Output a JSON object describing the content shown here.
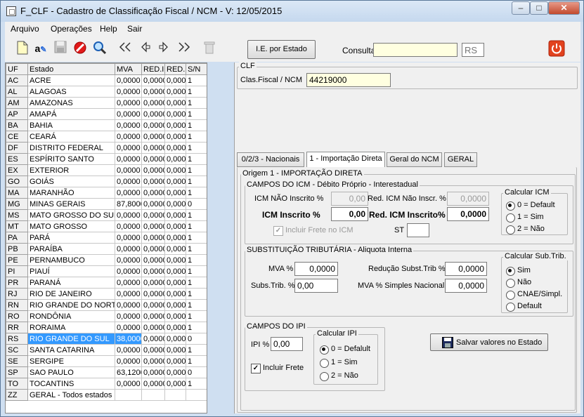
{
  "window": {
    "title": "F_CLF - Cadastro de Classificação Fiscal / NCM - V: 12/05/2015"
  },
  "menu": [
    "Arquivo",
    "Operações",
    "Help",
    "Sair"
  ],
  "toolbar": {
    "ie_button": "I.E. por Estado",
    "consulta_label": "Consulta",
    "consulta_value": "",
    "uf_value": "RS"
  },
  "grid": {
    "headers": [
      "UF",
      "Estado",
      "MVA",
      "RED.ICM",
      "RED.",
      "S/N"
    ],
    "rows": [
      [
        "AC",
        "ACRE",
        "0,0000",
        "0,0000",
        "0,000",
        "1"
      ],
      [
        "AL",
        "ALAGOAS",
        "0,0000",
        "0,0000",
        "0,000",
        "1"
      ],
      [
        "AM",
        "AMAZONAS",
        "0,0000",
        "0,0000",
        "0,000",
        "1"
      ],
      [
        "AP",
        "AMAPÁ",
        "0,0000",
        "0,0000",
        "0,000",
        "1"
      ],
      [
        "BA",
        "BAHIA",
        "0,0000",
        "0,0000",
        "0,000",
        "1"
      ],
      [
        "CE",
        "CEARÁ",
        "0,0000",
        "0,0000",
        "0,000",
        "1"
      ],
      [
        "DF",
        "DISTRITO FEDERAL",
        "0,0000",
        "0,0000",
        "0,000",
        "1"
      ],
      [
        "ES",
        "ESPÍRITO SANTO",
        "0,0000",
        "0,0000",
        "0,000",
        "1"
      ],
      [
        "EX",
        "EXTERIOR",
        "0,0000",
        "0,0000",
        "0,000",
        "1"
      ],
      [
        "GO",
        "GOIÁS",
        "0,0000",
        "0,0000",
        "0,000",
        "1"
      ],
      [
        "MA",
        "MARANHÃO",
        "0,0000",
        "0,0000",
        "0,000",
        "1"
      ],
      [
        "MG",
        "MINAS GERAIS",
        "87,8000",
        "0,0000",
        "0,000",
        "0"
      ],
      [
        "MS",
        "MATO GROSSO DO SUL",
        "0,0000",
        "0,0000",
        "0,000",
        "1"
      ],
      [
        "MT",
        "MATO GROSSO",
        "0,0000",
        "0,0000",
        "0,000",
        "1"
      ],
      [
        "PA",
        "PARÁ",
        "0,0000",
        "0,0000",
        "0,000",
        "1"
      ],
      [
        "PB",
        "PARAÍBA",
        "0,0000",
        "0,0000",
        "0,000",
        "1"
      ],
      [
        "PE",
        "PERNAMBUCO",
        "0,0000",
        "0,0000",
        "0,000",
        "1"
      ],
      [
        "PI",
        "PIAUÍ",
        "0,0000",
        "0,0000",
        "0,000",
        "1"
      ],
      [
        "PR",
        "PARANÁ",
        "0,0000",
        "0,0000",
        "0,000",
        "1"
      ],
      [
        "RJ",
        "RIO DE JANEIRO",
        "0,0000",
        "0,0000",
        "0,000",
        "1"
      ],
      [
        "RN",
        "RIO GRANDE DO NORTE",
        "0,0000",
        "0,0000",
        "0,000",
        "1"
      ],
      [
        "RO",
        "RONDÔNIA",
        "0,0000",
        "0,0000",
        "0,000",
        "1"
      ],
      [
        "RR",
        "RORAIMA",
        "0,0000",
        "0,0000",
        "0,000",
        "1"
      ],
      [
        "RS",
        "RIO GRANDE DO SUL",
        "38,0000",
        "0,0000",
        "0,000",
        "0"
      ],
      [
        "SC",
        "SANTA CATARINA",
        "0,0000",
        "0,0000",
        "0,000",
        "1"
      ],
      [
        "SE",
        "SERGIPE",
        "0,0000",
        "0,0000",
        "0,000",
        "1"
      ],
      [
        "SP",
        "SAO PAULO",
        "63,1200",
        "0,0000",
        "0,000",
        "0"
      ],
      [
        "TO",
        "TOCANTINS",
        "0,0000",
        "0,0000",
        "0,000",
        "1"
      ],
      [
        "ZZ",
        "GERAL - Todos estados",
        "",
        "",
        "",
        ""
      ]
    ],
    "selected_index": 23
  },
  "clf": {
    "group": "CLF",
    "label": "Clas.Fiscal / NCM",
    "value": "44219000"
  },
  "tabs": [
    "0/2/3 - Nacionais",
    "1 - Importação Direta",
    "Geral do NCM",
    "GERAL"
  ],
  "origin_group": "Origem 1 - IMPORTAÇÃO DIRETA",
  "icm": {
    "group": "CAMPOS DO ICM - Débito Próprio - Interestadual",
    "nao_inscrito_label": "ICM NÃO Inscrito %",
    "nao_inscrito_value": "0,00",
    "red_nao_inscr_label": "Red. ICM Não Inscr. %",
    "red_nao_inscr_value": "0,0000",
    "inscrito_label": "ICM Inscrito %",
    "inscrito_value": "0,00",
    "red_inscrito_label": "Red. ICM Inscrito%",
    "red_inscrito_value": "0,0000",
    "frete_label": "Incluir Frete no ICM",
    "st_label": "ST",
    "st_value": "",
    "calc_group": "Calcular ICM",
    "calc_options": [
      "0 = Default",
      "1 = Sim",
      "2 = Não"
    ]
  },
  "st": {
    "group": "SUBSTITUIÇÃO TRIBUTÁRIA - Aliquota Interna",
    "mva_label": "MVA %",
    "mva_value": "0,0000",
    "subs_label": "Subs.Trib. %",
    "subs_value": "0,00",
    "red_label": "Redução Subst.Trib %",
    "red_value": "0,0000",
    "mva_simples_label": "MVA % Simples Nacional",
    "mva_simples_value": "0,0000",
    "calc_group": "Calcular Sub.Trib.",
    "calc_options": [
      "Sim",
      "Não",
      "CNAE/Simpl.",
      "Default"
    ]
  },
  "ipi": {
    "group": "CAMPOS DO IPI",
    "ipi_label": "IPI %",
    "ipi_value": "0,00",
    "frete_label": "Incluir Frete",
    "calc_group": "Calcular IPI",
    "calc_options": [
      "0 = Defalult",
      "1 = Sim",
      "2 = Não"
    ]
  },
  "save_button": "Salvar valores no Estado"
}
